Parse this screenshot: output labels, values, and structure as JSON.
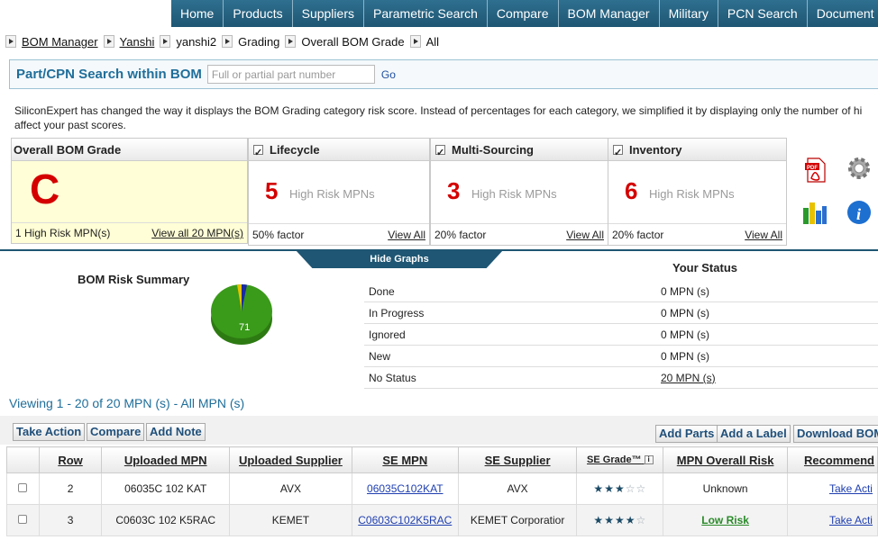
{
  "nav": [
    "Home",
    "Products",
    "Suppliers",
    "Parametric Search",
    "Compare",
    "BOM Manager",
    "Military",
    "PCN Search",
    "Document Cente"
  ],
  "breadcrumb": [
    "BOM Manager",
    "Yanshi",
    "yanshi2",
    "Grading",
    "Overall BOM Grade",
    "All"
  ],
  "search": {
    "label": "Part/CPN Search within BOM",
    "placeholder": "Full or partial part number",
    "go": "Go"
  },
  "notice": "SiliconExpert has changed the way it displays the BOM Grading category risk score. Instead of percentages for each category, we simplified it by displaying only the number of hi affect your past scores.",
  "overall": {
    "title": "Overall BOM Grade",
    "grade": "C",
    "high_risk": "1 High Risk MPN(s)",
    "view_all": "View all 20 MPN(s)"
  },
  "panels": [
    {
      "title": "Lifecycle",
      "count": "5",
      "label": "High Risk MPNs",
      "factor": "50% factor",
      "view_all": "View All"
    },
    {
      "title": "Multi-Sourcing",
      "count": "3",
      "label": "High Risk MPNs",
      "factor": "20% factor",
      "view_all": "View All"
    },
    {
      "title": "Inventory",
      "count": "6",
      "label": "High Risk MPNs",
      "factor": "20% factor",
      "view_all": "View All"
    }
  ],
  "hide_graphs": "Hide Graphs",
  "risk_summary": {
    "title": "BOM Risk Summary",
    "pie_label": "71"
  },
  "your_status": {
    "title": "Your Status",
    "rows": [
      {
        "k": "Done",
        "v": "0 MPN (s)"
      },
      {
        "k": "In Progress",
        "v": "0 MPN (s)"
      },
      {
        "k": "Ignored",
        "v": "0 MPN (s)"
      },
      {
        "k": "New",
        "v": "0 MPN (s)"
      },
      {
        "k": "No Status",
        "v": "20 MPN (s)"
      }
    ]
  },
  "viewing": "Viewing 1 - 20 of 20 MPN (s) - All MPN (s)",
  "buttons": {
    "take_action": "Take Action",
    "compare": "Compare",
    "add_note": "Add Note",
    "add_parts": "Add Parts",
    "add_label": "Add a Label",
    "download": "Download BOM"
  },
  "table": {
    "headers": [
      "Row",
      "Uploaded MPN",
      "Uploaded Supplier",
      "SE MPN",
      "SE Supplier",
      "SE Grade™",
      "MPN Overall Risk",
      "Recommend"
    ],
    "rows": [
      {
        "row": "2",
        "uploaded_mpn": "06035C 102 KAT",
        "uploaded_supplier": "AVX",
        "se_mpn": "06035C102KAT",
        "se_supplier": "AVX",
        "stars": 3,
        "risk": "Unknown",
        "action": "Take Acti"
      },
      {
        "row": "3",
        "uploaded_mpn": "C0603C 102 K5RAC",
        "uploaded_supplier": "KEMET",
        "se_mpn": "C0603C102K5RAC",
        "se_supplier": "KEMET Corporatior",
        "stars": 4,
        "risk": "Low Risk",
        "action": "Take Acti"
      }
    ]
  },
  "colors": {
    "nav": "#1e5673",
    "grade_red": "#d40000",
    "pie_green": "#3a9a1a",
    "pie_blue": "#1a2aa0",
    "pie_yellow": "#e8c200"
  }
}
